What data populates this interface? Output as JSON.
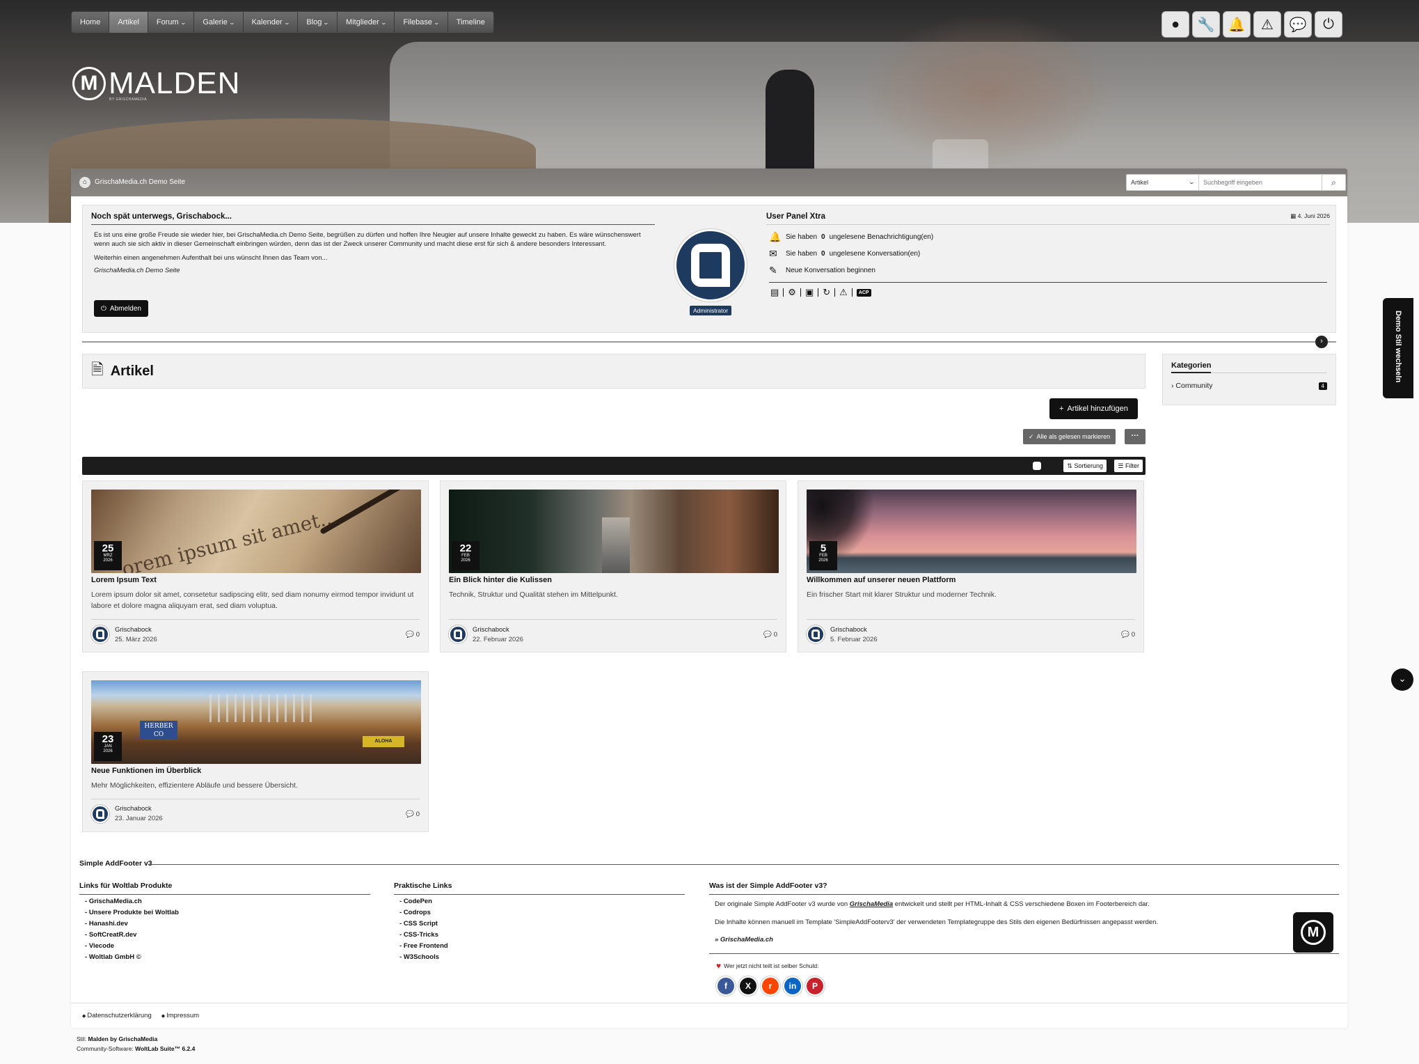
{
  "nav": {
    "items": [
      {
        "label": "Home",
        "active": false,
        "dropdown": false
      },
      {
        "label": "Artikel",
        "active": true,
        "dropdown": false
      },
      {
        "label": "Forum",
        "active": false,
        "dropdown": true
      },
      {
        "label": "Galerie",
        "active": false,
        "dropdown": true
      },
      {
        "label": "Kalender",
        "active": false,
        "dropdown": true
      },
      {
        "label": "Blog",
        "active": false,
        "dropdown": true
      },
      {
        "label": "Mitglieder",
        "active": false,
        "dropdown": true
      },
      {
        "label": "Filebase",
        "active": false,
        "dropdown": true
      },
      {
        "label": "Timeline",
        "active": false,
        "dropdown": false
      }
    ],
    "user_icons": [
      "user-circle-icon",
      "wrench-icon",
      "bell-icon",
      "warning-icon",
      "conversation-icon",
      "power-icon"
    ]
  },
  "logo": {
    "text": "MALDEN",
    "letter": "M",
    "sub": "BY GRISCHAMEDIA"
  },
  "breadcrumb": {
    "text": "GrischaMedia.ch Demo Seite"
  },
  "search": {
    "category": "Artikel",
    "placeholder": "Suchbegriff eingeben"
  },
  "welcome": {
    "title": "Noch spät unterwegs, Grischabock...",
    "text1": "Es ist uns eine große Freude sie wieder hier, bei GrischaMedia.ch Demo Seite, begrüßen zu dürfen und hoffen Ihre Neugier auf unsere Inhalte geweckt zu haben. Es wäre wünschenswert wenn auch sie sich aktiv in dieser Gemeinschaft einbringen würden, denn das ist der Zweck unserer Community und macht diese erst für sich & andere besonders Interessant.",
    "text2": "Weiterhin einen angenehmen Aufenthalt bei uns wünscht Ihnen das Team von...",
    "signature": "GrischaMedia.ch Demo Seite",
    "logout_label": "Abmelden",
    "role": "Administrator"
  },
  "user_panel": {
    "title": "User Panel Xtra",
    "date": "4. Juni 2026",
    "notif_prefix": "Sie haben",
    "notif_count": "0",
    "notif_suffix": "ungelesene Benachrichtigung(en)",
    "conv_prefix": "Sie haben",
    "conv_count": "0",
    "conv_suffix": "ungelesene Konversation(en)",
    "new_conversation": "Neue Konversation beginnen",
    "acp": "ACP"
  },
  "page": {
    "title": "Artikel",
    "add_button": "Artikel hinzufügen",
    "mark_read": "Alle als gelesen markieren",
    "more": "···",
    "sort_label": "Sortierung",
    "filter_label": "Filter"
  },
  "articles": [
    {
      "day": "25",
      "month": "MRZ",
      "year": "2026",
      "title": "Lorem Ipsum Text",
      "text": "Lorem ipsum dolor sit amet, consetetur sadipscing elitr, sed diam nonumy eirmod tempor invidunt ut labore et dolore magna aliquyam erat, sed diam voluptua.",
      "author": "Grischabock",
      "date": "25. März 2026",
      "comments": "0",
      "image_text": "orem ipsum sit amet..."
    },
    {
      "day": "22",
      "month": "FEB",
      "year": "2026",
      "title": "Ein Blick hinter die Kulissen",
      "text": "Technik, Struktur und Qualität stehen im Mittelpunkt.",
      "author": "Grischabock",
      "date": "22. Februar 2026",
      "comments": "0"
    },
    {
      "day": "5",
      "month": "FEB",
      "year": "2026",
      "title": "Willkommen auf unserer neuen Plattform",
      "text": "Ein frischer Start mit klarer Struktur und moderner Technik.",
      "author": "Grischabock",
      "date": "5. Februar 2026",
      "comments": "0"
    },
    {
      "day": "23",
      "month": "JAN",
      "year": "2026",
      "title": "Neue Funktionen im Überblick",
      "text": "Mehr Möglichkeiten, effizientere Abläufe und bessere Übersicht.",
      "author": "Grischabock",
      "date": "23. Januar 2026",
      "comments": "0",
      "sign_text": "HERBER CO",
      "sign2_text": "ALOHA"
    }
  ],
  "sidebar": {
    "title": "Kategorien",
    "items": [
      {
        "label": "Community",
        "count": "4"
      }
    ]
  },
  "demo_tab": "Demo Stil wechseln",
  "footer": {
    "title": "Simple AddFooter v3",
    "col1": {
      "title": "Links für Woltlab Produkte",
      "links": [
        "GrischaMedia.ch",
        "Unsere Produkte bei Woltlab",
        "Hanashi.dev",
        "SoftCreatR.dev",
        "Viecode",
        "Woltlab GmbH ©"
      ]
    },
    "col2": {
      "title": "Praktische Links",
      "links": [
        "CodePen",
        "Codrops",
        "CSS Script",
        "CSS-Tricks",
        "Free Frontend",
        "W3Schools"
      ]
    },
    "col3": {
      "title": "Was ist der Simple AddFooter v3?",
      "text1_a": "Der originale Simple AddFooter v3 wurde von",
      "text1_b": "GrischaMedia",
      "text1_c": "entwickelt und stellt per HTML-Inhalt & CSS verschiedene Boxen im Footerbereich dar.",
      "text2": "Die Inhalte können manuell im Template 'SimpleAddFooterv3' der verwendeten Templategruppe des Stils den eigenen Bedürfnissen angepasst werden.",
      "link": "» GrischaMedia.ch",
      "share_label": "Wer jetzt nicht teilt ist selber Schuld:"
    },
    "share": [
      {
        "name": "facebook-icon",
        "glyph": "f",
        "color": "#3b5998"
      },
      {
        "name": "x-icon",
        "glyph": "X",
        "color": "#111111"
      },
      {
        "name": "reddit-icon",
        "glyph": "r",
        "color": "#ff4500"
      },
      {
        "name": "linkedin-icon",
        "glyph": "in",
        "color": "#0a66c2"
      },
      {
        "name": "pinterest-icon",
        "glyph": "P",
        "color": "#c8232c"
      }
    ],
    "bottom_links": [
      "Datenschutzerklärung",
      "Impressum"
    ],
    "credits_style_label": "Stil:",
    "credits_style": "Malden by GrischaMedia",
    "credits_software_label": "Community-Software:",
    "credits_software": "WoltLab Suite™ 6.2.4"
  },
  "colors": {
    "accent": "#111111",
    "avatar": "#1e3a5f",
    "panel": "#f1f1f1"
  }
}
